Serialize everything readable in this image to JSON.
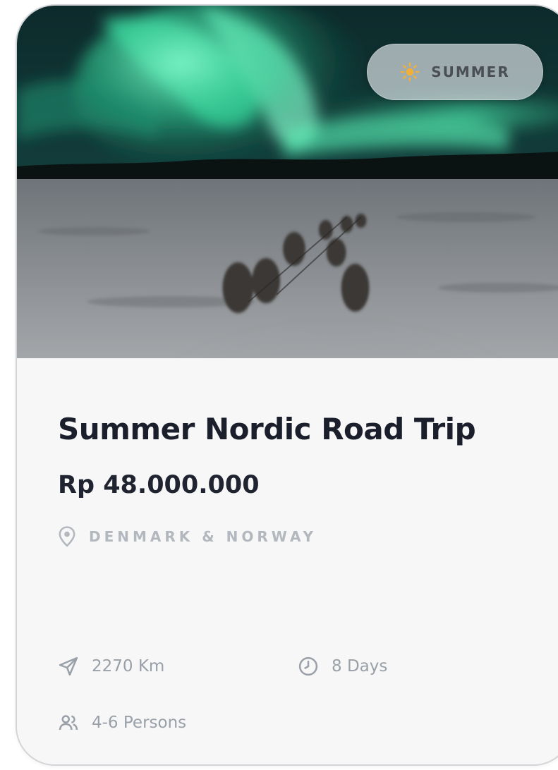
{
  "card": {
    "season_badge": {
      "icon": "sun-icon",
      "label": "SUMMER",
      "icon_color": "#f2b03a"
    },
    "title": "Summer Nordic Road Trip",
    "price": "Rp 48.000.000",
    "location": {
      "icon": "location-pin-icon",
      "label": "DENMARK & NORWAY"
    },
    "details": {
      "distance": {
        "icon": "navigation-arrow-icon",
        "label": "2270 Km"
      },
      "duration": {
        "icon": "clock-icon",
        "label": "8 Days"
      },
      "group_size": {
        "icon": "users-icon",
        "label": "4-6 Persons"
      }
    }
  }
}
